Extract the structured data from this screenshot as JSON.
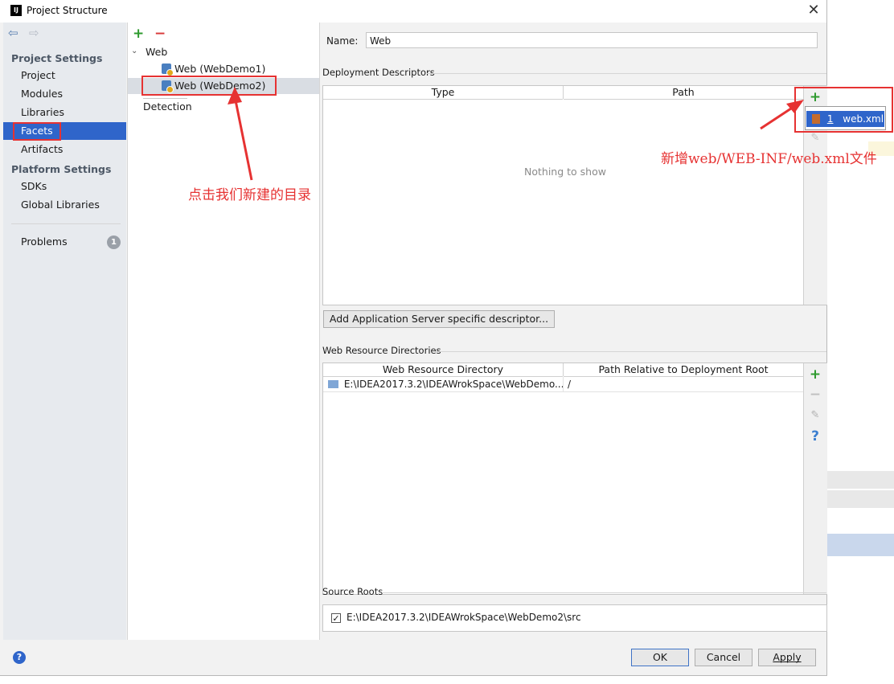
{
  "window": {
    "title": "Project Structure",
    "logo": "IJ",
    "close_glyph": "✕"
  },
  "left_nav": {
    "back_glyph": "⇦",
    "forward_glyph": "⇨",
    "project_settings_header": "Project Settings",
    "project_items": [
      "Project",
      "Modules",
      "Libraries",
      "Facets",
      "Artifacts"
    ],
    "platform_settings_header": "Platform Settings",
    "platform_items": [
      "SDKs",
      "Global Libraries"
    ],
    "problems_label": "Problems",
    "problems_count": "1"
  },
  "tree": {
    "add_glyph": "+",
    "remove_glyph": "−",
    "root_label": "Web",
    "children": [
      "Web (WebDemo1)",
      "Web (WebDemo2)"
    ],
    "detection_label": "Detection"
  },
  "facet": {
    "name_label": "Name:",
    "name_value": "Web",
    "deployment_descriptors_title": "Deployment Descriptors",
    "dd_columns": [
      "Type",
      "Path"
    ],
    "dd_empty_text": "Nothing to show",
    "dd_add_glyph": "+",
    "dd_popup_item_number": "1",
    "dd_popup_item_label": "web.xml",
    "add_app_server_button": "Add Application Server specific descriptor...",
    "web_resource_title": "Web Resource Directories",
    "wr_columns": [
      "Web Resource Directory",
      "Path Relative to Deployment Root"
    ],
    "wr_rows": [
      {
        "directory": "E:\\IDEA2017.3.2\\IDEAWrokSpace\\WebDemo...",
        "path": "/"
      }
    ],
    "wr_add_glyph": "+",
    "wr_remove_glyph": "−",
    "wr_edit_glyph": "✎",
    "wr_help_glyph": "?",
    "source_roots_title": "Source Roots",
    "source_root_path": "E:\\IDEA2017.3.2\\IDEAWrokSpace\\WebDemo2\\src",
    "source_root_checked": "✓"
  },
  "footer": {
    "help_glyph": "?",
    "ok_label": "OK",
    "cancel_label": "Cancel",
    "apply_label": "Apply"
  },
  "annotations": {
    "click_dir_text": "点击我们新建的目录",
    "new_webxml_text": "新增web/WEB-INF/web.xml文件"
  },
  "colors": {
    "selection_blue": "#2f65ca",
    "annotation_red": "#e63232",
    "add_green": "#2e9a2e",
    "remove_red": "#d93a3a"
  }
}
